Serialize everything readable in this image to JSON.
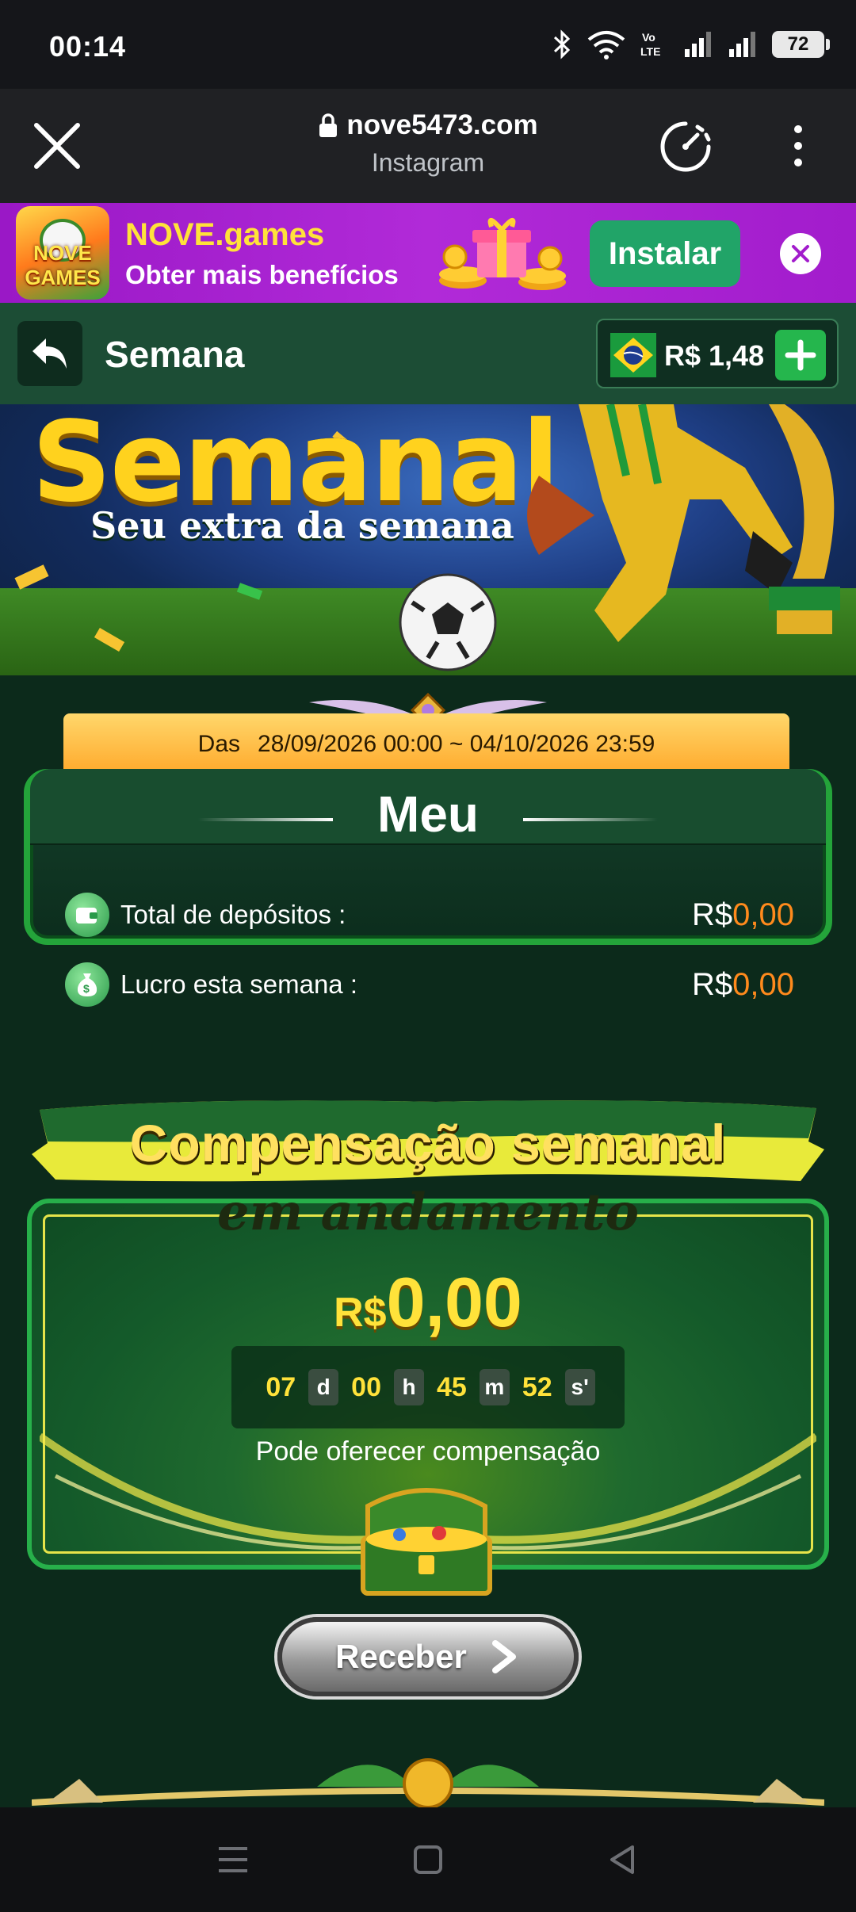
{
  "status_bar": {
    "time": "00:14",
    "battery": "72"
  },
  "browser": {
    "url": "nove5473.com",
    "source": "Instagram"
  },
  "install_banner": {
    "title": "NOVE.games",
    "subtitle": "Obter mais benefícios",
    "install_label": "Instalar",
    "logo_text": "NOVE GAMES"
  },
  "header": {
    "title": "Semana",
    "balance": "R$ 1,48"
  },
  "hero": {
    "title": "Semanal",
    "subtitle": "Seu extra da semana"
  },
  "period": {
    "prefix": "Das",
    "range": "28/09/2026 00:00 ~ 04/10/2026 23:59"
  },
  "meu": {
    "title": "Meu",
    "rows": [
      {
        "label": "Total de depósitos :",
        "currency": "R$",
        "value": "0,00"
      },
      {
        "label": "Lucro esta semana :",
        "currency": "R$",
        "value": "0,00"
      }
    ]
  },
  "compensation": {
    "title_line1": "Compensação semanal",
    "title_line2": "em andamento",
    "currency": "R$",
    "amount": "0,00",
    "timer": {
      "days": "07",
      "days_unit": "d",
      "hours": "00",
      "hours_unit": "h",
      "minutes": "45",
      "minutes_unit": "m",
      "seconds": "52",
      "seconds_unit": "s'"
    },
    "note": "Pode oferecer compensação",
    "button_label": "Receber"
  },
  "colors": {
    "brand_purple": "#a21ccc",
    "install_green": "#21a468",
    "header_green": "#1c4d35",
    "page_bg": "#0c2a1b",
    "gold": "#ffe23a",
    "amount_orange": "#ff8a1c"
  },
  "icons": [
    "close-icon",
    "lock-icon",
    "speed-dial-icon",
    "more-vert-icon",
    "back-arrow-icon",
    "brazil-flag-icon",
    "plus-icon",
    "wallet-icon",
    "money-bag-icon",
    "chevron-right-icon",
    "menu-icon",
    "home-icon",
    "back-icon"
  ]
}
